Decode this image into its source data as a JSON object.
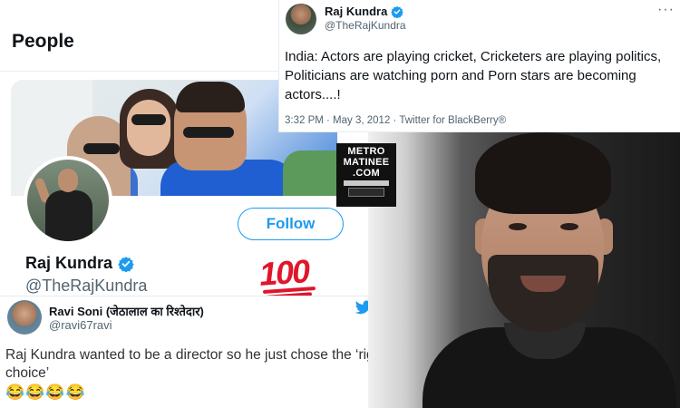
{
  "people_card": {
    "title": "People",
    "name": "Raj Kundra",
    "handle": "@TheRajKundra",
    "follow_label": "Follow",
    "sticker": "100"
  },
  "tweet_reply": {
    "name": "Ravi Soni (जेठालाल का रिश्तेदार)",
    "handle": "@ravi67ravi",
    "text": "Raj Kundra wanted to be a director so he just chose the ‘right choice’",
    "emojis": "😂😂😂😂"
  },
  "tweet_main": {
    "name": "Raj Kundra",
    "handle": "@TheRajKundra",
    "more": "···",
    "text": "India: Actors are playing cricket,  Cricketers are playing politics,  Politicians are watching porn  and Porn stars are becoming actors....!",
    "meta": "3:32 PM · May 3, 2012 · Twitter for BlackBerry®"
  },
  "logo": {
    "line1": "METRO",
    "line2": "MATINEE",
    "line3": ".COM"
  },
  "colors": {
    "accent": "#1d9bf0",
    "text_primary": "#0f1419",
    "text_secondary": "#536471",
    "sticker_red": "#e0162b"
  },
  "icons": {
    "verified": "verified-badge-icon",
    "bird": "twitter-bird-icon",
    "more": "more-icon"
  }
}
